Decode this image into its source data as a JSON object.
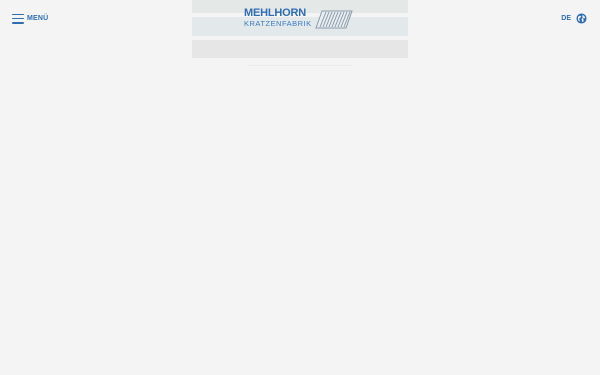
{
  "header": {
    "menu_label": "MENÜ",
    "language_label": "DE"
  },
  "logo": {
    "top_text": "MEHLHORN",
    "bottom_text": "KRATZENFABRIK"
  },
  "colors": {
    "brand_blue": "#2f6db3",
    "background": "#f4f4f4"
  },
  "icons": {
    "menu": "hamburger-icon",
    "language": "globe-icon"
  }
}
